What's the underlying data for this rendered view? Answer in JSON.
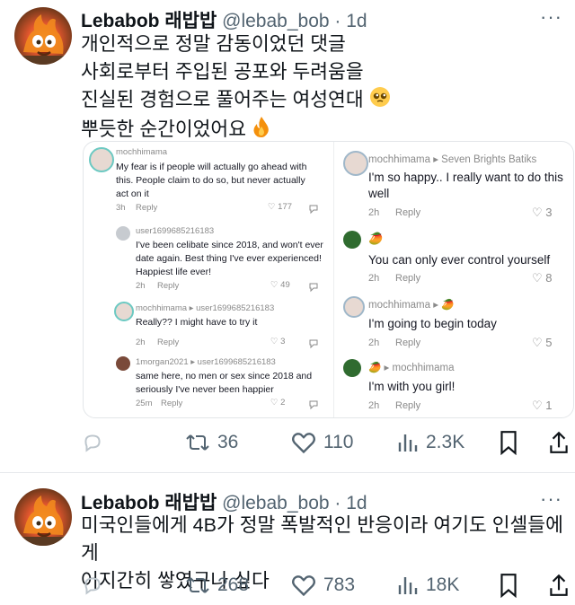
{
  "tweets": [
    {
      "display_name": "Lebabob 래밥밥",
      "handle": "@lebab_bob",
      "separator": "·",
      "time": "1d",
      "more": "···",
      "text_lines": [
        "개인적으로 정말 감동이었던 댓글",
        "사회로부터 주입된 공포와 두려움을",
        "진실된 경험으로 풀어주는 여성연대",
        "뿌듯한 순간이었어요"
      ],
      "emojis": [
        "pleading-face-emoji",
        "fire-emoji"
      ],
      "actions": {
        "reply": "",
        "retweets": "36",
        "likes": "110",
        "views": "2.3K"
      },
      "embedded_comments": {
        "left": [
          {
            "user": "mochhimama",
            "text": "My fear is if people will actually go ahead with this. People claim to do so, but never actually act on it",
            "time": "3h",
            "reply": "Reply",
            "likes": "177"
          },
          {
            "user": "user1699685216183",
            "text": "I've been celibate since 2018, and won't ever date again. Best thing I've ever experienced! Happiest life ever!",
            "time": "2h",
            "reply": "Reply",
            "likes": "49"
          },
          {
            "user": "mochhimama ▸ user1699685216183",
            "text": "Really?? I might have to try it",
            "time": "2h",
            "reply": "Reply",
            "likes": "3"
          },
          {
            "user": "1morgan2021 ▸ user1699685216183",
            "text": "same here, no men or sex since 2018 and seriously I've never been happier",
            "time": "25m",
            "reply": "Reply",
            "likes": "2"
          }
        ],
        "right": [
          {
            "user": "mochhimama ▸ Seven Brights Batiks",
            "text": "I'm so happy.. I really want to do this well",
            "time": "2h",
            "reply": "Reply",
            "likes": "3"
          },
          {
            "user": "",
            "text": "You can only ever control yourself",
            "time": "2h",
            "reply": "Reply",
            "likes": "8"
          },
          {
            "user": "mochhimama ▸",
            "text": "I'm going to begin today",
            "time": "2h",
            "reply": "Reply",
            "likes": "5"
          },
          {
            "user": "▸ mochhimama",
            "text": "I'm with you girl!",
            "time": "2h",
            "reply": "Reply",
            "likes": "1"
          }
        ]
      }
    },
    {
      "display_name": "Lebabob 래밥밥",
      "handle": "@lebab_bob",
      "separator": "·",
      "time": "1d",
      "more": "···",
      "text_lines": [
        "미국인들에게 4B가 정말 폭발적인 반응이라 여기도 인셀들에게",
        "어지간히 쌓였구나 싶다"
      ],
      "actions": {
        "reply": "",
        "retweets": "268",
        "likes": "783",
        "views": "18K"
      }
    }
  ],
  "colors": {
    "text": "#0f1419",
    "secondary": "#536471",
    "divider": "#e6e9ec"
  }
}
